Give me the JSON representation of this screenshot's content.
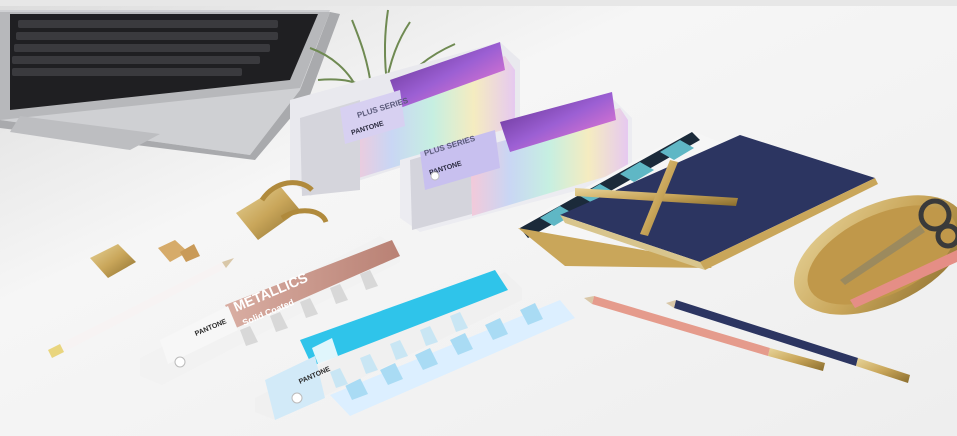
{
  "colors": {
    "background": "#f3f3f3",
    "laptop": "#c9cacd",
    "rose_gold": "#c9968a",
    "cyan": "#2fc4ea",
    "navy": "#2c3561",
    "brass": "#c9a65a"
  },
  "guides": {
    "plus_pastels_label": "PLUS SERIES",
    "plus_pastels_brand": "PANTONE",
    "plus_metallics_label": "PLUS SERIES",
    "plus_metallics_brand": "PANTONE",
    "metallics_title": "METALLICS",
    "metallics_subtitle": "Solid Coated",
    "metallics_brand": "PANTONE",
    "pastels_brand": "PANTONE"
  },
  "icons": [
    "laptop-icon",
    "plant-icon",
    "binder-clip-icon",
    "pencil-sharpener-icon",
    "pencil-icon",
    "tray-icon",
    "scissors-icon",
    "notebook-icon"
  ]
}
